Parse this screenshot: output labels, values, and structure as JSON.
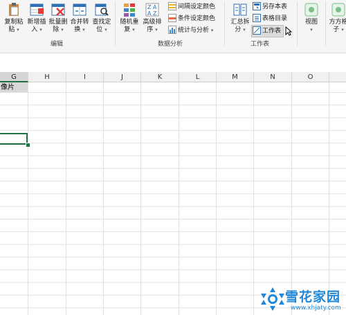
{
  "ribbon": {
    "groups": {
      "edit_label": "编辑",
      "analysis_label": "数据分析",
      "worksheet_label": "工作表"
    },
    "buttons": {
      "copy_paste": [
        "复制粘",
        "贴"
      ],
      "insert_new": [
        "新增插",
        "入"
      ],
      "batch_delete": [
        "批量删",
        "除"
      ],
      "merge_convert": [
        "合并转",
        "换"
      ],
      "find_locate": [
        "查找定",
        "位"
      ],
      "random_repeat": [
        "随机重",
        "复"
      ],
      "advanced_sort": [
        "高级排",
        "序"
      ],
      "summary_split": [
        "汇总拆",
        "分"
      ],
      "view": [
        "视图",
        ""
      ],
      "fangfang": [
        "方方格",
        "子"
      ]
    },
    "small": {
      "interval_color": "间隔设定颜色",
      "condition_color": "条件设定颜色",
      "stats_analysis": "统计与分析",
      "save_sheet": "另存本表",
      "sheet_catalog": "表格目录",
      "worksheet": "工作表"
    }
  },
  "sheet": {
    "columns": [
      "G",
      "H",
      "I",
      "J",
      "K",
      "L",
      "M",
      "N",
      "O"
    ],
    "selected_column": "G",
    "cells": {
      "G1": "像片"
    }
  },
  "watermark": {
    "title": "雪花家园",
    "url": "www.xhjaty.com"
  },
  "colors": {
    "accent_green": "#217346",
    "watermark_blue": "#1f88d8"
  },
  "icons": {
    "copy_paste": "clipboard-icon",
    "insert_new": "insert-icon",
    "batch_delete": "delete-icon",
    "merge_convert": "merge-icon",
    "find_locate": "find-icon",
    "random_repeat": "random-icon",
    "advanced_sort": "sort-az-icon",
    "summary_split": "split-icon",
    "view": "view-icon",
    "fangfang": "grid-icon"
  }
}
